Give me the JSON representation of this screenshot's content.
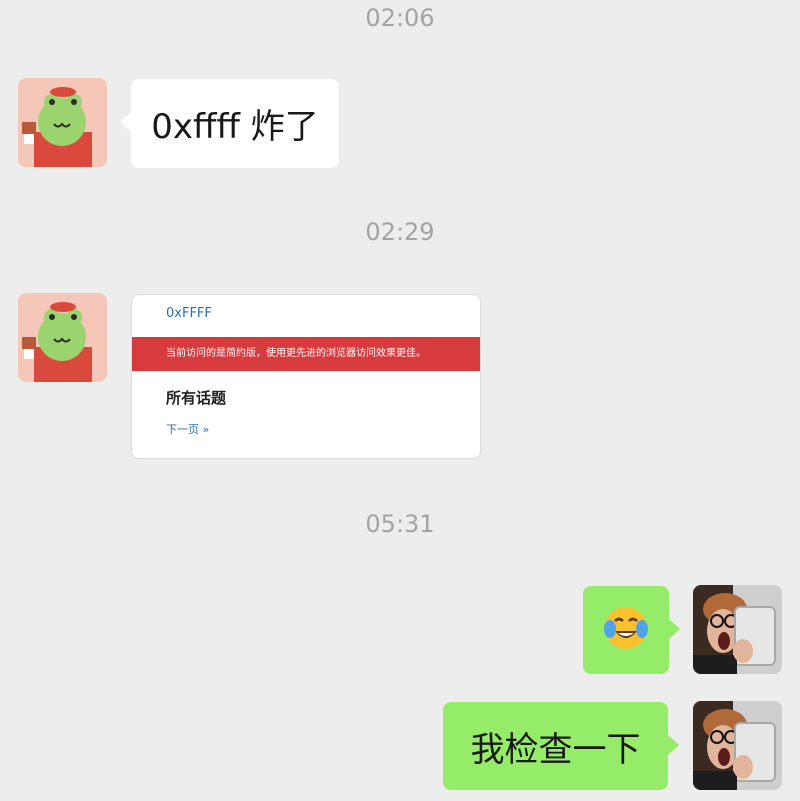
{
  "messages": [
    {
      "time": "02:06",
      "sender": "other",
      "text": "0xffff 炸了"
    },
    {
      "time": "02:29",
      "sender": "other",
      "card": {
        "site": "0xFFFF",
        "banner": "当前访问的是简约版，使用更先进的浏览器访问效果更佳。",
        "heading": "所有话题",
        "next": "下一页 »"
      }
    },
    {
      "time": "05:31",
      "sender": "self",
      "emoji": "😭",
      "emoji_name": "face-with-tears-of-joy"
    },
    {
      "sender": "self",
      "text": "我检查一下"
    }
  ],
  "colors": {
    "background": "#ededed",
    "incoming_bubble": "#ffffff",
    "outgoing_bubble": "#95ec69",
    "timestamp": "#a3a3a3",
    "card_banner": "#d73b3e",
    "card_link": "#2a6fa8"
  },
  "icons": {
    "other_avatar": "frog-avatar-icon",
    "self_avatar": "photo-avatar-icon"
  }
}
